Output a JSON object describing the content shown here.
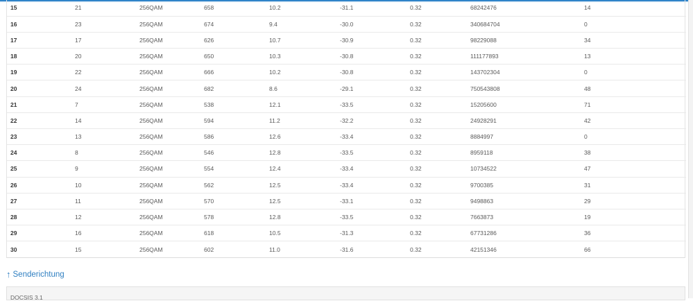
{
  "rows": [
    [
      "15",
      "21",
      "256QAM",
      "658",
      "10.2",
      "-31.1",
      "0.32",
      "68242476",
      "14"
    ],
    [
      "16",
      "23",
      "256QAM",
      "674",
      "9.4",
      "-30.0",
      "0.32",
      "340684704",
      "0"
    ],
    [
      "17",
      "17",
      "256QAM",
      "626",
      "10.7",
      "-30.9",
      "0.32",
      "98229088",
      "34"
    ],
    [
      "18",
      "20",
      "256QAM",
      "650",
      "10.3",
      "-30.8",
      "0.32",
      "111177893",
      "13"
    ],
    [
      "19",
      "22",
      "256QAM",
      "666",
      "10.2",
      "-30.8",
      "0.32",
      "143702304",
      "0"
    ],
    [
      "20",
      "24",
      "256QAM",
      "682",
      "8.6",
      "-29.1",
      "0.32",
      "750543808",
      "48"
    ],
    [
      "21",
      "7",
      "256QAM",
      "538",
      "12.1",
      "-33.5",
      "0.32",
      "15205600",
      "71"
    ],
    [
      "22",
      "14",
      "256QAM",
      "594",
      "11.2",
      "-32.2",
      "0.32",
      "24928291",
      "42"
    ],
    [
      "23",
      "13",
      "256QAM",
      "586",
      "12.6",
      "-33.4",
      "0.32",
      "8884997",
      "0"
    ],
    [
      "24",
      "8",
      "256QAM",
      "546",
      "12.8",
      "-33.5",
      "0.32",
      "8959118",
      "38"
    ],
    [
      "25",
      "9",
      "256QAM",
      "554",
      "12.4",
      "-33.4",
      "0.32",
      "10734522",
      "47"
    ],
    [
      "26",
      "10",
      "256QAM",
      "562",
      "12.5",
      "-33.4",
      "0.32",
      "9700385",
      "31"
    ],
    [
      "27",
      "11",
      "256QAM",
      "570",
      "12.5",
      "-33.1",
      "0.32",
      "9498863",
      "29"
    ],
    [
      "28",
      "12",
      "256QAM",
      "578",
      "12.8",
      "-33.5",
      "0.32",
      "7663873",
      "19"
    ],
    [
      "29",
      "16",
      "256QAM",
      "618",
      "10.5",
      "-31.3",
      "0.32",
      "67731286",
      "36"
    ],
    [
      "30",
      "15",
      "256QAM",
      "602",
      "11.0",
      "-31.6",
      "0.32",
      "42151346",
      "66"
    ]
  ],
  "section_link": {
    "arrow": "↑",
    "label": "Senderichtung"
  },
  "panel": {
    "title": "DOCSIS 3.1"
  },
  "colors": {
    "accent": "#2f83c8",
    "link": "#2f7fc1"
  }
}
